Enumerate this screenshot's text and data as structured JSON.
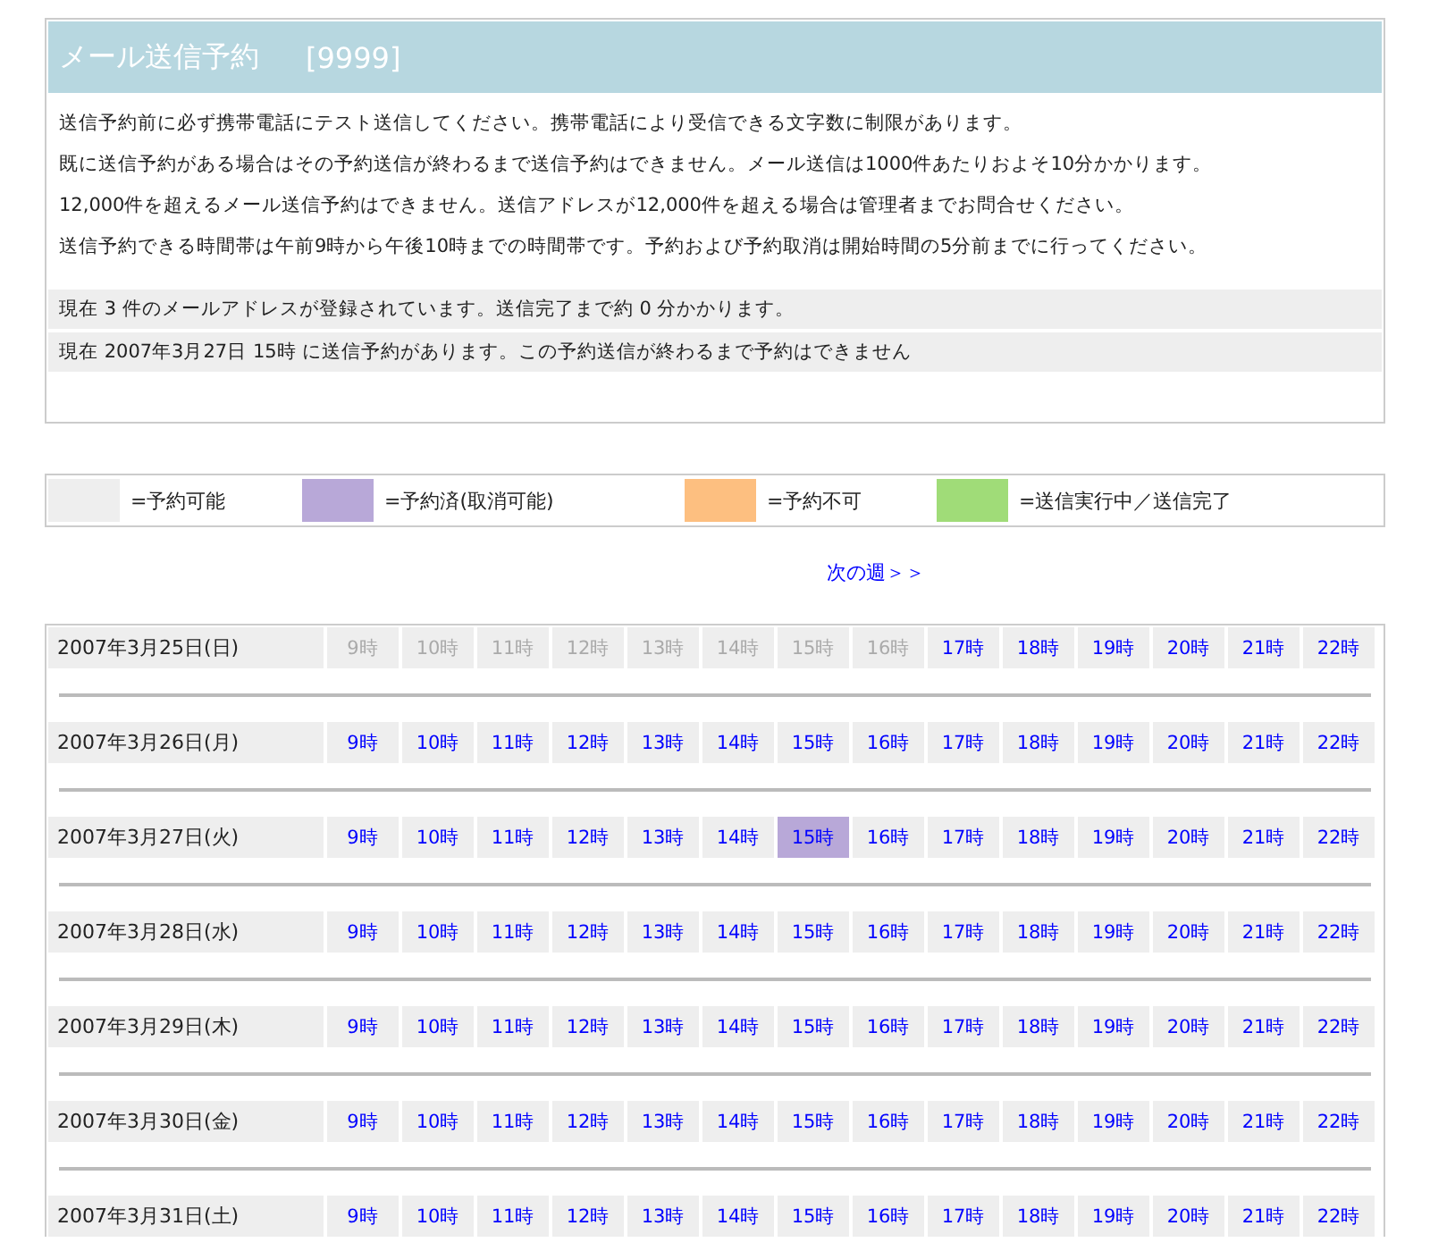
{
  "header": {
    "title": "メール送信予約",
    "code": "[9999]"
  },
  "notes": [
    "送信予約前に必ず携帯電話にテスト送信してください。携帯電話により受信できる文字数に制限があります。",
    "既に送信予約がある場合はその予約送信が終わるまで送信予約はできません。メール送信は1000件あたりおよそ10分かかります。",
    "12,000件を超えるメール送信予約はできません。送信アドレスが12,000件を超える場合は管理者までお問合せください。",
    "送信予約できる時間帯は午前9時から午後10時までの時間帯です。予約および予約取消は開始時間の5分前までに行ってください。"
  ],
  "status": [
    "現在  3 件のメールアドレスが登録されています。送信完了まで約  0  分かかります。",
    "現在  2007年3月27日 15時  に送信予約があります。この予約送信が終わるまで予約はできません"
  ],
  "legend": [
    {
      "color": "#eeeeee",
      "label": "=予約可能"
    },
    {
      "color": "#b8a8d8",
      "label": "=予約済(取消可能)"
    },
    {
      "color": "#fdbf80",
      "label": "=予約不可"
    },
    {
      "color": "#a0dc78",
      "label": "=送信実行中／送信完了"
    }
  ],
  "next_week": "次の週＞＞",
  "days": [
    {
      "date": "2007年3月25日(日)",
      "slots": [
        {
          "label": "9時",
          "kind": "past"
        },
        {
          "label": "10時",
          "kind": "past"
        },
        {
          "label": "11時",
          "kind": "past"
        },
        {
          "label": "12時",
          "kind": "past"
        },
        {
          "label": "13時",
          "kind": "past"
        },
        {
          "label": "14時",
          "kind": "past"
        },
        {
          "label": "15時",
          "kind": "past"
        },
        {
          "label": "16時",
          "kind": "past"
        },
        {
          "label": "17時",
          "kind": "open"
        },
        {
          "label": "18時",
          "kind": "open"
        },
        {
          "label": "19時",
          "kind": "open"
        },
        {
          "label": "20時",
          "kind": "open"
        },
        {
          "label": "21時",
          "kind": "open"
        },
        {
          "label": "22時",
          "kind": "open"
        }
      ]
    },
    {
      "date": "2007年3月26日(月)",
      "slots": [
        {
          "label": "9時",
          "kind": "open"
        },
        {
          "label": "10時",
          "kind": "open"
        },
        {
          "label": "11時",
          "kind": "open"
        },
        {
          "label": "12時",
          "kind": "open"
        },
        {
          "label": "13時",
          "kind": "open"
        },
        {
          "label": "14時",
          "kind": "open"
        },
        {
          "label": "15時",
          "kind": "open"
        },
        {
          "label": "16時",
          "kind": "open"
        },
        {
          "label": "17時",
          "kind": "open"
        },
        {
          "label": "18時",
          "kind": "open"
        },
        {
          "label": "19時",
          "kind": "open"
        },
        {
          "label": "20時",
          "kind": "open"
        },
        {
          "label": "21時",
          "kind": "open"
        },
        {
          "label": "22時",
          "kind": "open"
        }
      ]
    },
    {
      "date": "2007年3月27日(火)",
      "slots": [
        {
          "label": "9時",
          "kind": "open"
        },
        {
          "label": "10時",
          "kind": "open"
        },
        {
          "label": "11時",
          "kind": "open"
        },
        {
          "label": "12時",
          "kind": "open"
        },
        {
          "label": "13時",
          "kind": "open"
        },
        {
          "label": "14時",
          "kind": "open"
        },
        {
          "label": "15時",
          "kind": "booked"
        },
        {
          "label": "16時",
          "kind": "open"
        },
        {
          "label": "17時",
          "kind": "open"
        },
        {
          "label": "18時",
          "kind": "open"
        },
        {
          "label": "19時",
          "kind": "open"
        },
        {
          "label": "20時",
          "kind": "open"
        },
        {
          "label": "21時",
          "kind": "open"
        },
        {
          "label": "22時",
          "kind": "open"
        }
      ]
    },
    {
      "date": "2007年3月28日(水)",
      "slots": [
        {
          "label": "9時",
          "kind": "open"
        },
        {
          "label": "10時",
          "kind": "open"
        },
        {
          "label": "11時",
          "kind": "open"
        },
        {
          "label": "12時",
          "kind": "open"
        },
        {
          "label": "13時",
          "kind": "open"
        },
        {
          "label": "14時",
          "kind": "open"
        },
        {
          "label": "15時",
          "kind": "open"
        },
        {
          "label": "16時",
          "kind": "open"
        },
        {
          "label": "17時",
          "kind": "open"
        },
        {
          "label": "18時",
          "kind": "open"
        },
        {
          "label": "19時",
          "kind": "open"
        },
        {
          "label": "20時",
          "kind": "open"
        },
        {
          "label": "21時",
          "kind": "open"
        },
        {
          "label": "22時",
          "kind": "open"
        }
      ]
    },
    {
      "date": "2007年3月29日(木)",
      "slots": [
        {
          "label": "9時",
          "kind": "open"
        },
        {
          "label": "10時",
          "kind": "open"
        },
        {
          "label": "11時",
          "kind": "open"
        },
        {
          "label": "12時",
          "kind": "open"
        },
        {
          "label": "13時",
          "kind": "open"
        },
        {
          "label": "14時",
          "kind": "open"
        },
        {
          "label": "15時",
          "kind": "open"
        },
        {
          "label": "16時",
          "kind": "open"
        },
        {
          "label": "17時",
          "kind": "open"
        },
        {
          "label": "18時",
          "kind": "open"
        },
        {
          "label": "19時",
          "kind": "open"
        },
        {
          "label": "20時",
          "kind": "open"
        },
        {
          "label": "21時",
          "kind": "open"
        },
        {
          "label": "22時",
          "kind": "open"
        }
      ]
    },
    {
      "date": "2007年3月30日(金)",
      "slots": [
        {
          "label": "9時",
          "kind": "open"
        },
        {
          "label": "10時",
          "kind": "open"
        },
        {
          "label": "11時",
          "kind": "open"
        },
        {
          "label": "12時",
          "kind": "open"
        },
        {
          "label": "13時",
          "kind": "open"
        },
        {
          "label": "14時",
          "kind": "open"
        },
        {
          "label": "15時",
          "kind": "open"
        },
        {
          "label": "16時",
          "kind": "open"
        },
        {
          "label": "17時",
          "kind": "open"
        },
        {
          "label": "18時",
          "kind": "open"
        },
        {
          "label": "19時",
          "kind": "open"
        },
        {
          "label": "20時",
          "kind": "open"
        },
        {
          "label": "21時",
          "kind": "open"
        },
        {
          "label": "22時",
          "kind": "open"
        }
      ]
    },
    {
      "date": "2007年3月31日(土)",
      "slots": [
        {
          "label": "9時",
          "kind": "open"
        },
        {
          "label": "10時",
          "kind": "open"
        },
        {
          "label": "11時",
          "kind": "open"
        },
        {
          "label": "12時",
          "kind": "open"
        },
        {
          "label": "13時",
          "kind": "open"
        },
        {
          "label": "14時",
          "kind": "open"
        },
        {
          "label": "15時",
          "kind": "open"
        },
        {
          "label": "16時",
          "kind": "open"
        },
        {
          "label": "17時",
          "kind": "open"
        },
        {
          "label": "18時",
          "kind": "open"
        },
        {
          "label": "19時",
          "kind": "open"
        },
        {
          "label": "20時",
          "kind": "open"
        },
        {
          "label": "21時",
          "kind": "open"
        },
        {
          "label": "22時",
          "kind": "open"
        }
      ]
    }
  ]
}
